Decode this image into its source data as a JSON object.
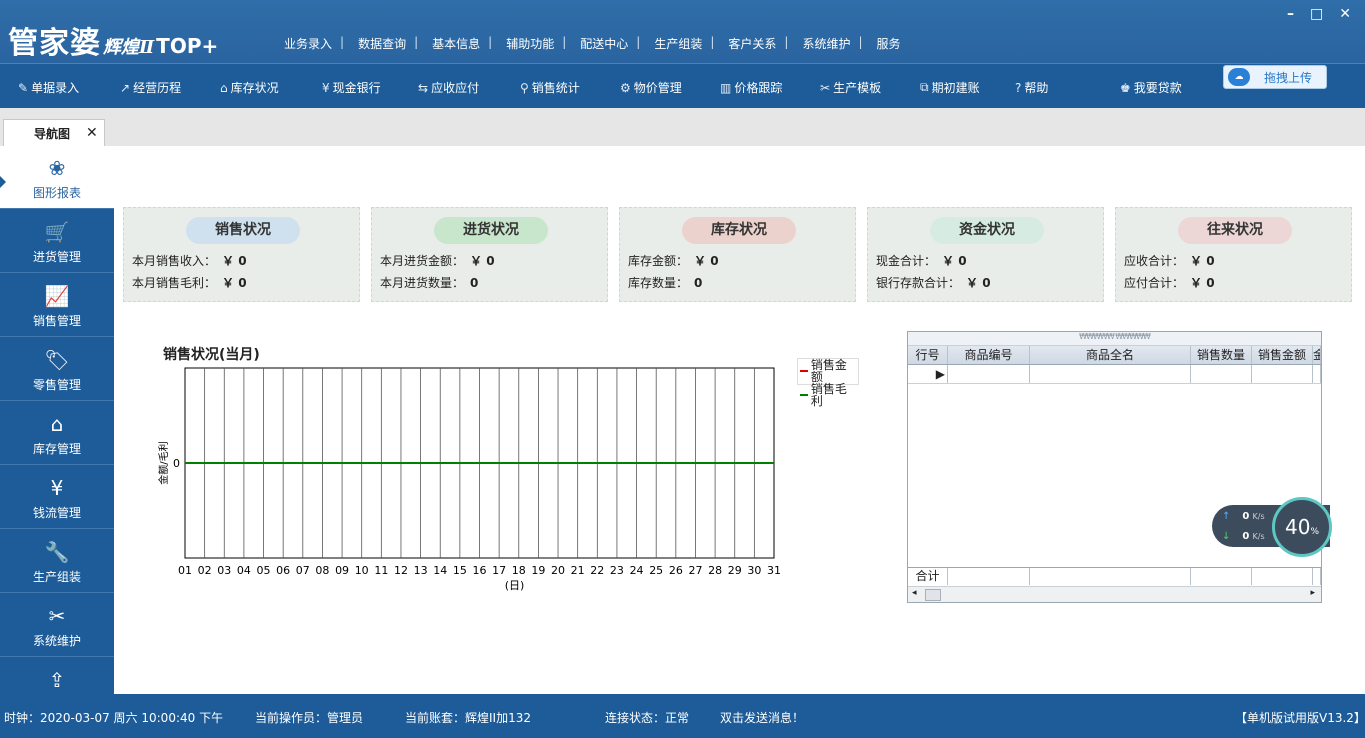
{
  "logo": {
    "main": "管家婆",
    "sub": "辉煌Ⅱ",
    "brand": "TOP+"
  },
  "window_controls": [
    "–",
    "□",
    "✕"
  ],
  "top_menu": [
    "业务录入",
    "数据查询",
    "基本信息",
    "辅助功能",
    "配送中心",
    "生产组装",
    "客户关系",
    "系统维护",
    "服务"
  ],
  "toolbar": [
    {
      "label": "单据录入",
      "icon": "document-edit-icon",
      "glyph": "✎"
    },
    {
      "label": "经营历程",
      "icon": "trend-icon",
      "glyph": "↗"
    },
    {
      "label": "库存状况",
      "icon": "warehouse-icon",
      "glyph": "⌂"
    },
    {
      "label": "现金银行",
      "icon": "yen-icon",
      "glyph": "¥"
    },
    {
      "label": "应收应付",
      "icon": "exchange-icon",
      "glyph": "⇆"
    },
    {
      "label": "销售统计",
      "icon": "search-icon",
      "glyph": "⚲"
    },
    {
      "label": "物价管理",
      "icon": "gear-icon",
      "glyph": "⚙"
    },
    {
      "label": "价格跟踪",
      "icon": "bar-chart-icon",
      "glyph": "▥"
    },
    {
      "label": "生产模板",
      "icon": "wrench-icon",
      "glyph": "✂"
    },
    {
      "label": "期初建账",
      "icon": "external-link-icon",
      "glyph": "⧉"
    },
    {
      "label": "帮助",
      "icon": "help-icon",
      "glyph": "?"
    },
    {
      "label": "我要贷款",
      "icon": "loan-icon",
      "glyph": "♚"
    }
  ],
  "upload_button": "拖拽上传",
  "nav_tab": {
    "label": "导航图",
    "close": "✕"
  },
  "sidebar": [
    {
      "label": "图形报表",
      "icon": "graph-report-icon",
      "glyph": "❀"
    },
    {
      "label": "进货管理",
      "icon": "cart-icon",
      "glyph": "🛒"
    },
    {
      "label": "销售管理",
      "icon": "line-chart-icon",
      "glyph": "📈"
    },
    {
      "label": "零售管理",
      "icon": "tag-icon",
      "glyph": "🏷"
    },
    {
      "label": "库存管理",
      "icon": "house-icon",
      "glyph": "⌂"
    },
    {
      "label": "钱流管理",
      "icon": "money-icon",
      "glyph": "¥"
    },
    {
      "label": "生产组装",
      "icon": "tool-icon",
      "glyph": "🔧"
    },
    {
      "label": "系统维护",
      "icon": "tools-icon",
      "glyph": "✂"
    },
    {
      "label": "",
      "icon": "share-icon",
      "glyph": "⇪"
    }
  ],
  "cards": [
    {
      "title": "销售状况",
      "color": "#cfe0ee",
      "rows": [
        {
          "label": "本月销售收入：",
          "value": "￥ 0"
        },
        {
          "label": "本月销售毛利：",
          "value": "￥ 0"
        }
      ]
    },
    {
      "title": "进货状况",
      "color": "#c8e6cc",
      "rows": [
        {
          "label": "本月进货金额：",
          "value": "￥ 0"
        },
        {
          "label": "本月进货数量：",
          "value": "0"
        }
      ]
    },
    {
      "title": "库存状况",
      "color": "#ecd2cc",
      "rows": [
        {
          "label": "库存金额：",
          "value": "￥ 0"
        },
        {
          "label": "库存数量：",
          "value": "0"
        }
      ]
    },
    {
      "title": "资金状况",
      "color": "#d6ece2",
      "rows": [
        {
          "label": "现金合计：",
          "value": "￥ 0"
        },
        {
          "label": "银行存款合计：",
          "value": "￥ 0"
        }
      ]
    },
    {
      "title": "往来状况",
      "color": "#ecd6d6",
      "rows": [
        {
          "label": "应收合计：",
          "value": "￥ 0"
        },
        {
          "label": "应付合计：",
          "value": "￥ 0"
        }
      ]
    }
  ],
  "chart_data": {
    "type": "line",
    "title": "销售状况(当月)",
    "xlabel": "(日)",
    "ylabel": "金额/毛利",
    "categories": [
      "01",
      "02",
      "03",
      "04",
      "05",
      "06",
      "07",
      "08",
      "09",
      "10",
      "11",
      "12",
      "13",
      "14",
      "15",
      "16",
      "17",
      "18",
      "19",
      "20",
      "21",
      "22",
      "23",
      "24",
      "25",
      "26",
      "27",
      "28",
      "29",
      "30",
      "31"
    ],
    "series": [
      {
        "name": "销售金额",
        "color": "#e00000",
        "values": [
          0,
          0,
          0,
          0,
          0,
          0,
          0,
          0,
          0,
          0,
          0,
          0,
          0,
          0,
          0,
          0,
          0,
          0,
          0,
          0,
          0,
          0,
          0,
          0,
          0,
          0,
          0,
          0,
          0,
          0,
          0
        ]
      },
      {
        "name": "销售毛利",
        "color": "#008000",
        "values": [
          0,
          0,
          0,
          0,
          0,
          0,
          0,
          0,
          0,
          0,
          0,
          0,
          0,
          0,
          0,
          0,
          0,
          0,
          0,
          0,
          0,
          0,
          0,
          0,
          0,
          0,
          0,
          0,
          0,
          0,
          0
        ]
      }
    ],
    "yticks": [
      "0"
    ],
    "ylim": [
      -1,
      1
    ],
    "grid": true,
    "legend": "top-right"
  },
  "grid": {
    "top_hint": "₩₩₩₩₩   ₩₩₩₩₩",
    "columns": [
      {
        "label": "行号"
      },
      {
        "label": "商品编号"
      },
      {
        "label": "商品全名"
      },
      {
        "label": "销售数量"
      },
      {
        "label": "销售金额"
      },
      {
        "label": "金"
      }
    ],
    "footer_label": "合计",
    "row_pointer": "▶"
  },
  "net_widget": {
    "up": "0",
    "down": "0",
    "unit": "K/s",
    "percent": "40",
    "percent_unit": "%"
  },
  "status": {
    "clock": "时钟：2020-03-07 周六 10:00:40 下午",
    "operator": "当前操作员：管理员",
    "account": "当前账套：辉煌II加132",
    "connection": "连接状态：正常",
    "message": "双击发送消息！",
    "version": "【单机版试用版V13.2】"
  }
}
